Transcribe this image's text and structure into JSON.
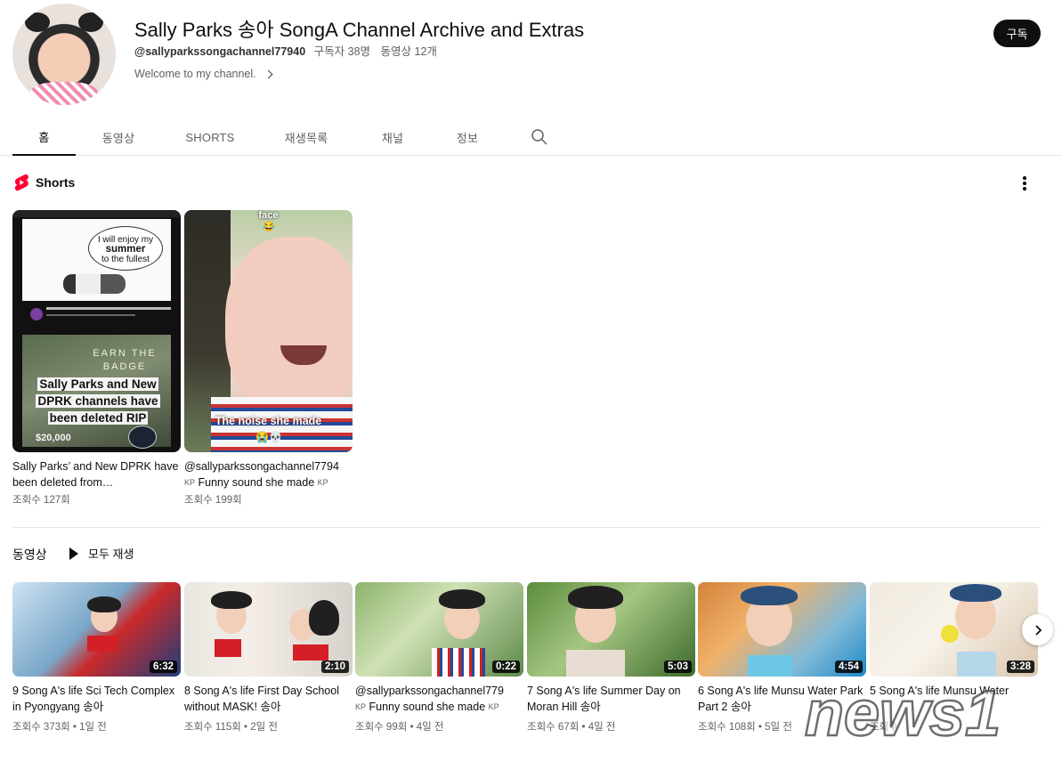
{
  "channel": {
    "title": "Sally Parks 송아 SongA Channel Archive and Extras",
    "handle": "@sallyparkssongachannel77940",
    "subscribers": "구독자 38명",
    "video_count": "동영상 12개",
    "description": "Welcome to my channel.",
    "subscribe_label": "구독"
  },
  "tabs": [
    {
      "label": "홈",
      "active": true
    },
    {
      "label": "동영상"
    },
    {
      "label": "SHORTS"
    },
    {
      "label": "재생목록"
    },
    {
      "label": "채널"
    },
    {
      "label": "정보"
    }
  ],
  "shorts_section": {
    "title": "Shorts",
    "items": [
      {
        "title": "Sally Parks’ and New DPRK have been deleted from…",
        "views": "조회수 127회",
        "thumb_text": {
          "bubble_1": "I will enjoy my",
          "bubble_2": "summer",
          "bubble_3": "to the fullest",
          "earn": "EARN THE BADGE",
          "caption": "Sally Parks and New DPRK channels have been deleted RIP",
          "money": "$20,000"
        }
      },
      {
        "title_1": "@sallyparkssongachannel7794",
        "title_2": "Funny sound she made",
        "kp": "KP",
        "views": "조회수 199회",
        "thumb_text": {
          "top": "face",
          "caption": "The noise she made"
        }
      }
    ]
  },
  "videos_section": {
    "title": "동영상",
    "play_all": "모두 재생",
    "items": [
      {
        "title": "9 Song A's life Sci Tech Complex in Pyongyang 송아",
        "meta": "조회수 373회 • 1일 전",
        "duration": "6:32"
      },
      {
        "title": "8 Song A's life First Day School without MASK! 송아",
        "meta": "조회수 115회 • 2일 전",
        "duration": "2:10"
      },
      {
        "title_1": "@sallyparkssongachannel779",
        "title_2": "Funny sound she made",
        "kp": "KP",
        "meta": "조회수 99회 • 4일 전",
        "duration": "0:22"
      },
      {
        "title": "7 Song A's life Summer Day on Moran Hill 송아",
        "meta": "조회수 67회 • 4일 전",
        "duration": "5:03"
      },
      {
        "title": "6 Song A's life Munsu Water Park Part 2 송아",
        "meta": "조회수 108회 • 5일 전",
        "duration": "4:54"
      },
      {
        "title": "5 Song A's life Munsu Water",
        "meta": "조회수",
        "duration": "3:28"
      }
    ]
  },
  "watermark": "news1",
  "icons": {
    "search": "search-icon",
    "more": "more-vert-icon",
    "next": "chevron-right-icon",
    "shorts": "shorts-logo-icon",
    "play": "play-icon"
  },
  "colors": {
    "brand_red": "#ff0033",
    "text_primary": "#0f0f0f",
    "text_secondary": "#606060",
    "subscribe_bg": "#0f0f0f"
  }
}
